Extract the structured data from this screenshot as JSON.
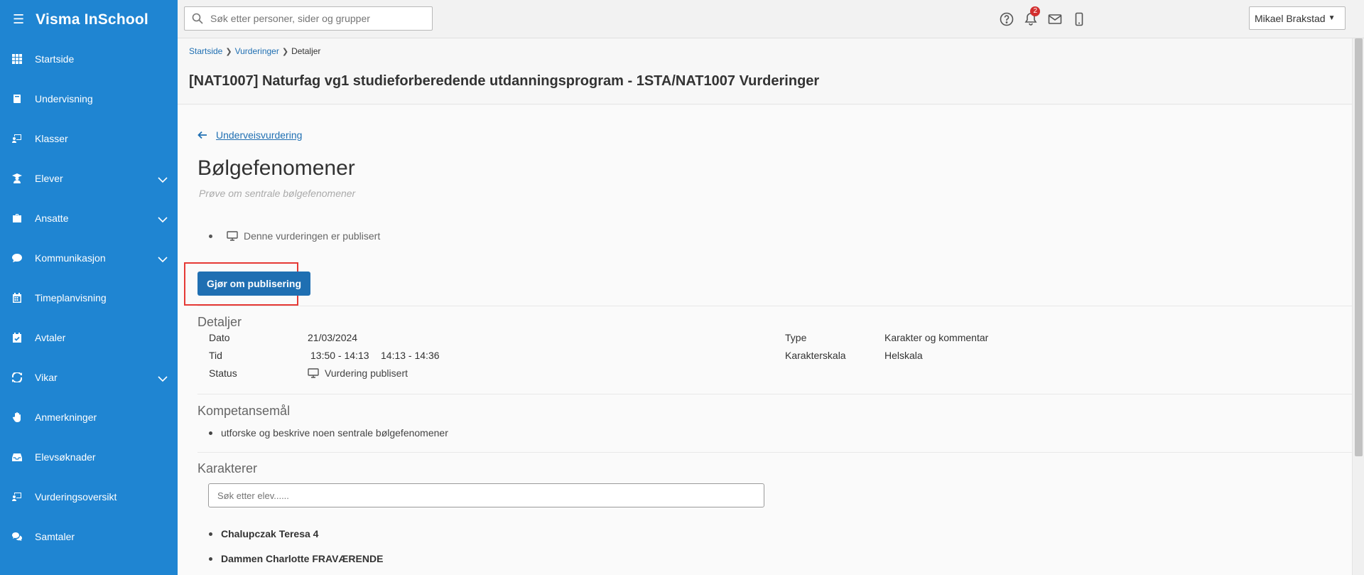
{
  "app": {
    "title": "Visma InSchool"
  },
  "sidebar": {
    "items": [
      {
        "label": "Startside",
        "icon": "grid-icon",
        "expandable": false
      },
      {
        "label": "Undervisning",
        "icon": "book-icon",
        "expandable": false
      },
      {
        "label": "Klasser",
        "icon": "classroom-icon",
        "expandable": false
      },
      {
        "label": "Elever",
        "icon": "student-icon",
        "expandable": true
      },
      {
        "label": "Ansatte",
        "icon": "briefcase-icon",
        "expandable": true
      },
      {
        "label": "Kommunikasjon",
        "icon": "chat-bubble-icon",
        "expandable": true
      },
      {
        "label": "Timeplanvisning",
        "icon": "calendar-icon",
        "expandable": false
      },
      {
        "label": "Avtaler",
        "icon": "calendar-check-icon",
        "expandable": false
      },
      {
        "label": "Vikar",
        "icon": "refresh-icon",
        "expandable": true
      },
      {
        "label": "Anmerkninger",
        "icon": "hand-icon",
        "expandable": false
      },
      {
        "label": "Elevsøknader",
        "icon": "inbox-icon",
        "expandable": false
      },
      {
        "label": "Vurderingsoversikt",
        "icon": "classroom-icon",
        "expandable": false
      },
      {
        "label": "Samtaler",
        "icon": "chat-bubbles-icon",
        "expandable": false
      }
    ]
  },
  "topbar": {
    "search_placeholder": "Søk etter personer, sider og grupper",
    "notification_count": "2",
    "user_name": "Mikael Brakstad"
  },
  "breadcrumb": {
    "items": [
      "Startside",
      "Vurderinger"
    ],
    "current": "Detaljer"
  },
  "page": {
    "title": "[NAT1007] Naturfag vg1 studieforberedende utdanningsprogram - 1STA/NAT1007 Vurderinger"
  },
  "assessment": {
    "back_label": "Underveisvurdering",
    "name": "Bølgefenomener",
    "description": "Prøve om sentrale bølgefenomener",
    "published_note": "Denne vurderingen er publisert",
    "redo_button": "Gjør om publisering"
  },
  "details": {
    "heading": "Detaljer",
    "date_label": "Dato",
    "date_value": "21/03/2024",
    "time_label": "Tid",
    "time_value_1": "13:50 - 14:13",
    "time_value_2": "14:13 - 14:36",
    "status_label": "Status",
    "status_value": "Vurdering publisert",
    "type_label": "Type",
    "type_value": "Karakter og kommentar",
    "scale_label": "Karakterskala",
    "scale_value": "Helskala"
  },
  "competence": {
    "heading": "Kompetansemål",
    "goals": [
      "utforske og beskrive noen sentrale bølgefenomener"
    ]
  },
  "grades": {
    "heading": "Karakterer",
    "search_placeholder": "Søk etter elev......",
    "students": [
      "Chalupczak Teresa 4",
      "Dammen Charlotte FRAVÆRENDE"
    ]
  }
}
